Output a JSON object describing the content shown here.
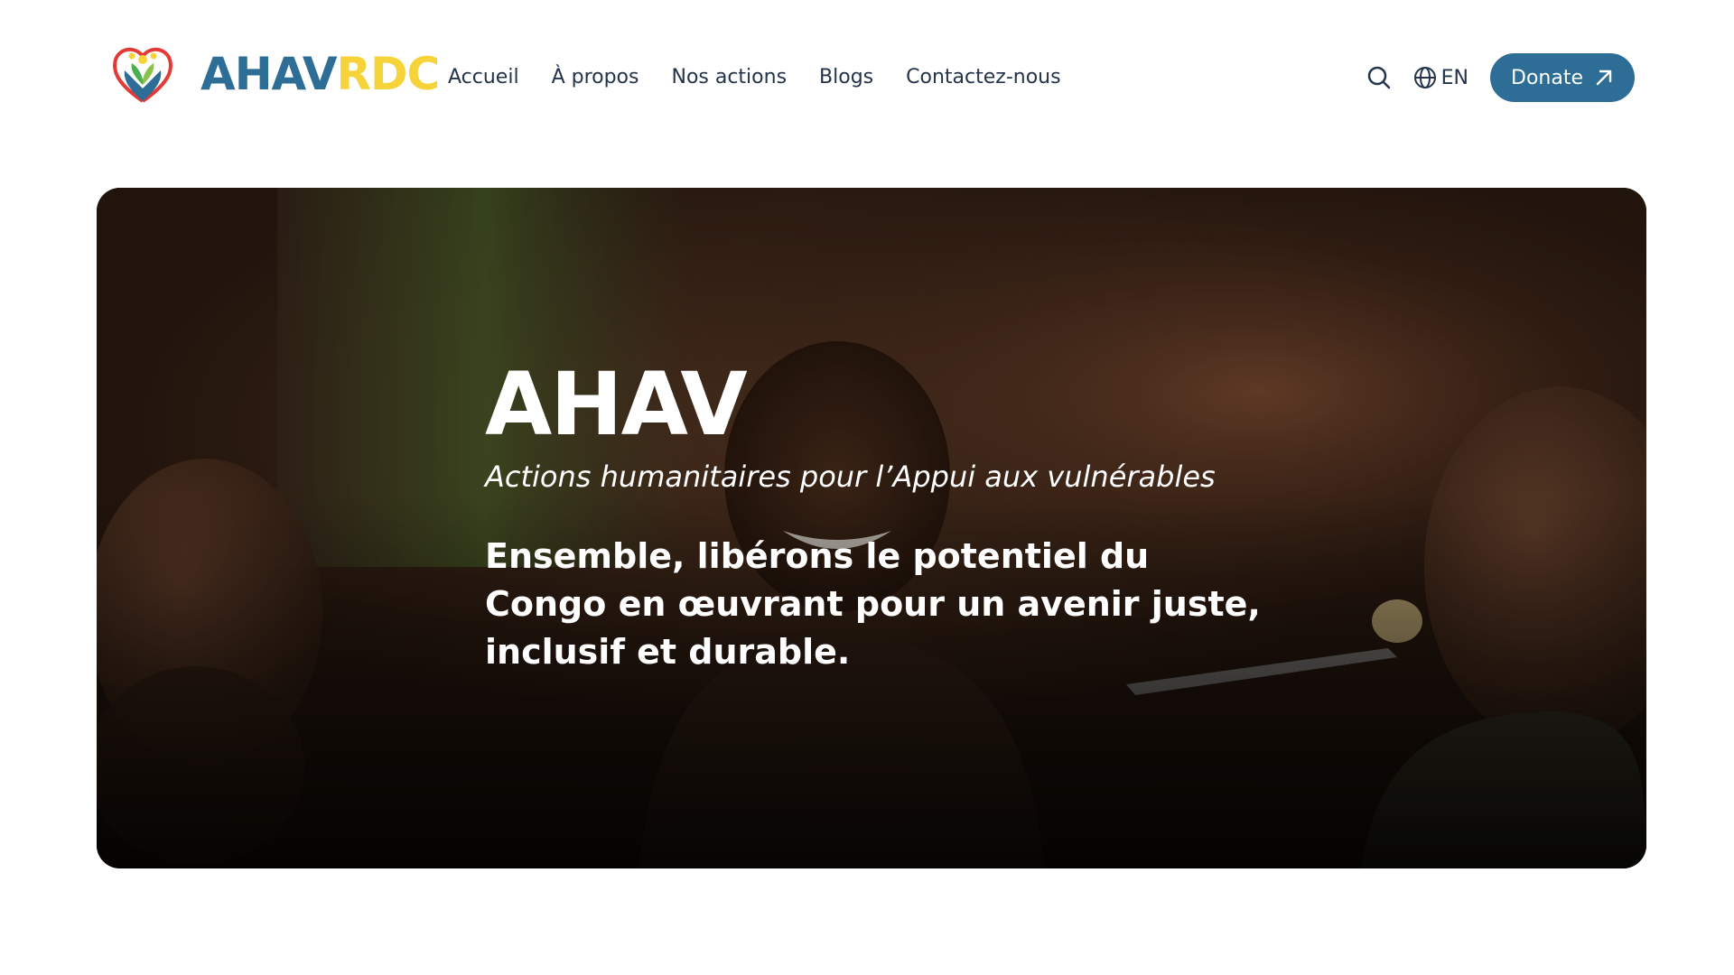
{
  "header": {
    "logo": {
      "text_part1": "AHAV",
      "text_part2": "RDC",
      "icon": "heart-hands-logo-icon"
    },
    "nav": [
      {
        "label": "Accueil"
      },
      {
        "label": "À propos"
      },
      {
        "label": "Nos actions"
      },
      {
        "label": "Blogs"
      },
      {
        "label": "Contactez-nous"
      }
    ],
    "search_icon": "search-icon",
    "language": {
      "icon": "globe-icon",
      "label": "EN"
    },
    "donate": {
      "label": "Donate",
      "icon": "arrow-up-right-icon"
    }
  },
  "hero": {
    "title": "AHAV",
    "subtitle": "Actions humanitaires pour l’Appui aux vulnérables",
    "tagline": "Ensemble, libérons le potentiel du Congo en œuvrant pour un avenir juste, inclusif et durable."
  },
  "colors": {
    "brand_blue": "#2e6e96",
    "brand_yellow": "#f7d33a",
    "nav_text": "#24344a"
  }
}
